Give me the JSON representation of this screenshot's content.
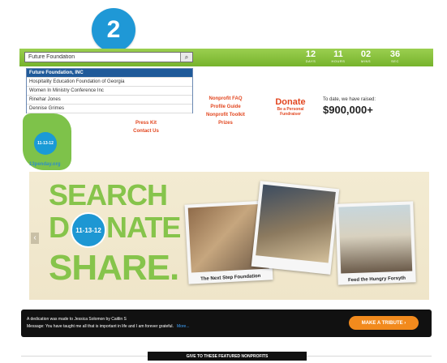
{
  "step_badge": "2",
  "search": {
    "value": "Future Foundation",
    "button_icon": "search-icon"
  },
  "countdown": [
    {
      "value": "12",
      "unit": "DAYS"
    },
    {
      "value": "11",
      "unit": "HOURS"
    },
    {
      "value": "02",
      "unit": "MINS"
    },
    {
      "value": "36",
      "unit": "SEC"
    }
  ],
  "suggestions": [
    "Future Foundation, INC",
    "Hospitality Education Foundation of Georgia",
    "Women In Ministry Conference Inc",
    "Rinehar Jones",
    "Dennise Grimes"
  ],
  "links": {
    "press_kit": "Press Kit",
    "contact_us": "Contact Us",
    "nonprofit_faq": "Nonprofit FAQ",
    "profile_guide": "Profile Guide",
    "nonprofit_toolkit": "Nonprofit Toolkit",
    "prizes": "Prizes",
    "donate": "Donate",
    "personal_fundraiser": "Be a Personal Fundraiser"
  },
  "raised": {
    "label": "To date, we have raised:",
    "amount": "$900,000+"
  },
  "logo": {
    "date": "11-13-12",
    "url": "13penday.org"
  },
  "banner": {
    "word1": "SEARCH",
    "word2_prefix": "D",
    "word2_suffix": "NATE",
    "word3": "SHARE.",
    "date": "11-13-12",
    "captions": [
      "The Next Step Foundation",
      "Feed the Hungry Forsyth"
    ]
  },
  "dedication": {
    "line1": "A dedication was made to Jessica Solomon by Caitlin S",
    "line2": "Message: You have taught me all that is important in life and I am forever grateful.",
    "more": "More...",
    "tribute_button": "MAKE A TRIBUTE"
  },
  "featured": "GIVE TO THESE FEATURED NONPROFITS",
  "colors": {
    "badge": "#1f98d6",
    "green": "#86c44b",
    "orange": "#e2461f",
    "button": "#f28a1d"
  }
}
